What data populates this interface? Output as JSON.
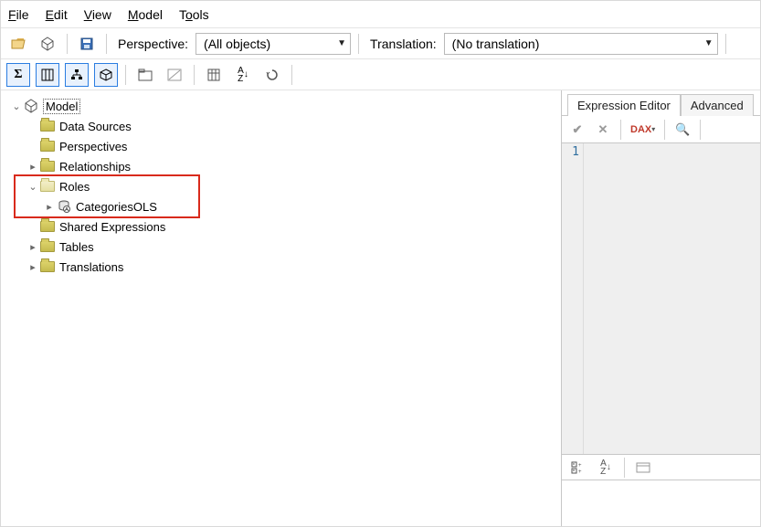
{
  "menu": {
    "file": "File",
    "edit": "Edit",
    "view": "View",
    "model": "Model",
    "tools": "Tools"
  },
  "toolbar1": {
    "perspective_label": "Perspective:",
    "perspective_value": "(All objects)",
    "translation_label": "Translation:",
    "translation_value": "(No translation)"
  },
  "tree": {
    "root": "Model",
    "data_sources": "Data Sources",
    "perspectives": "Perspectives",
    "relationships": "Relationships",
    "roles": "Roles",
    "roles_child": "CategoriesOLS",
    "shared_expr": "Shared Expressions",
    "tables": "Tables",
    "translations": "Translations"
  },
  "right": {
    "tab_expr": "Expression Editor",
    "tab_adv": "Advanced",
    "gutter_line": "1",
    "dax": "DAX"
  }
}
